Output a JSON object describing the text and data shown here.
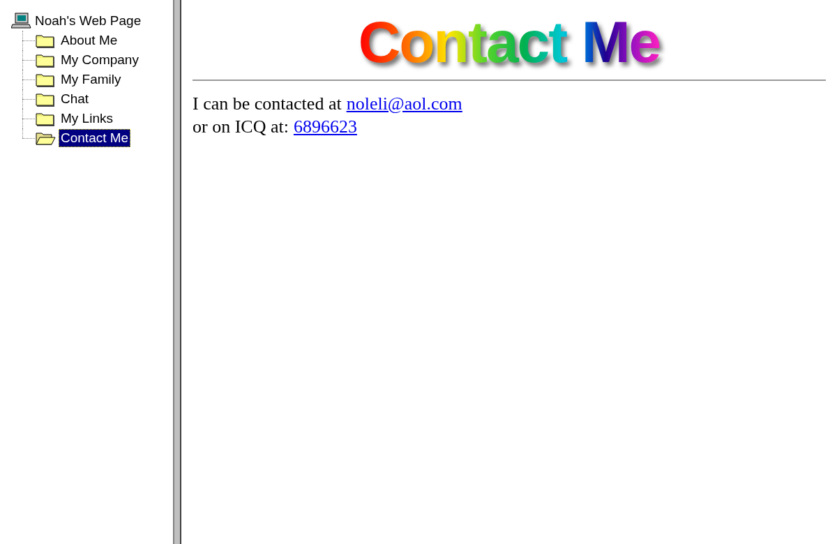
{
  "sidebar": {
    "root": {
      "label": "Noah's Web Page"
    },
    "items": [
      {
        "label": "About Me",
        "selected": false
      },
      {
        "label": "My Company",
        "selected": false
      },
      {
        "label": "My Family",
        "selected": false
      },
      {
        "label": "Chat",
        "selected": false
      },
      {
        "label": "My Links",
        "selected": false
      },
      {
        "label": "Contact Me",
        "selected": true
      }
    ]
  },
  "content": {
    "heading": "Contact Me",
    "lines": [
      {
        "text": "I can be contacted at",
        "link": "noleli@aol.com"
      },
      {
        "text": "or on ICQ at:",
        "link": "6896623"
      }
    ]
  }
}
